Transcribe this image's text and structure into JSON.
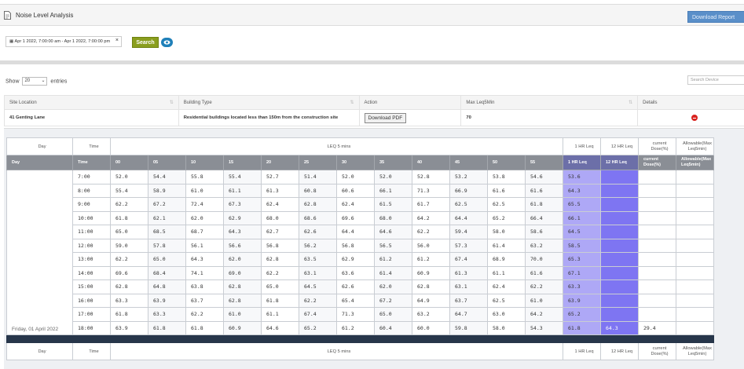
{
  "header": {
    "title": "Noise Level Analysis",
    "download_report": "Download Report"
  },
  "filter": {
    "date_range": "Apr 1 2022, 7:00:00 am - Apr 1 2022, 7:00:00 pm",
    "search_label": "Search"
  },
  "list": {
    "show_label": "Show",
    "entries_value": "20",
    "entries_label": "entries",
    "search_placeholder": "Search Device"
  },
  "site_table": {
    "headers": [
      "Site Location",
      "Building Type",
      "Action",
      "Max Leq5Min",
      "Details"
    ],
    "row": {
      "site": "41 Genting Lane",
      "building": "Residential buildings located less than 150m from the construction site",
      "action": "Download PDF",
      "max_leq": "70"
    }
  },
  "leq_table": {
    "h_day": "Day",
    "h_time": "Time",
    "h_leq": "LEQ 5 mins",
    "h_1hr": "1 HR Leq",
    "h_12hr": "12 HR Leq",
    "h_dose": "current Dose(%)",
    "h_allow": "Allowable(Max Leq5min)",
    "minutes": [
      "00",
      "05",
      "10",
      "15",
      "20",
      "25",
      "30",
      "35",
      "40",
      "45",
      "50",
      "55"
    ],
    "rows": [
      {
        "time": "7:00",
        "v": [
          "52.0",
          "54.4",
          "55.8",
          "55.4",
          "52.7",
          "51.4",
          "52.0",
          "52.0",
          "52.8",
          "53.2",
          "53.8",
          "54.6"
        ],
        "hr": "53.6"
      },
      {
        "time": "8:00",
        "v": [
          "55.4",
          "58.9",
          "61.0",
          "61.1",
          "61.3",
          "60.8",
          "60.6",
          "66.1",
          "71.3",
          "66.9",
          "61.6",
          "61.6"
        ],
        "hr": "64.3"
      },
      {
        "time": "9:00",
        "v": [
          "62.2",
          "67.2",
          "72.4",
          "67.3",
          "62.4",
          "62.8",
          "62.4",
          "61.5",
          "61.7",
          "62.5",
          "62.5",
          "61.8"
        ],
        "hr": "65.5"
      },
      {
        "time": "10:00",
        "v": [
          "61.8",
          "62.1",
          "62.0",
          "62.9",
          "68.0",
          "68.6",
          "69.6",
          "68.0",
          "64.2",
          "64.4",
          "65.2",
          "66.4"
        ],
        "hr": "66.1"
      },
      {
        "time": "11:00",
        "v": [
          "65.0",
          "68.5",
          "68.7",
          "64.3",
          "62.7",
          "62.6",
          "64.4",
          "64.6",
          "62.2",
          "59.4",
          "58.0",
          "58.6"
        ],
        "hr": "64.5"
      },
      {
        "time": "12:00",
        "v": [
          "59.0",
          "57.8",
          "56.1",
          "56.6",
          "56.8",
          "56.2",
          "56.8",
          "56.5",
          "56.0",
          "57.3",
          "61.4",
          "63.2"
        ],
        "hr": "58.5"
      },
      {
        "time": "13:00",
        "v": [
          "62.2",
          "65.0",
          "64.3",
          "62.0",
          "62.8",
          "63.5",
          "62.9",
          "61.2",
          "61.2",
          "67.4",
          "68.9",
          "70.0"
        ],
        "hr": "65.3"
      },
      {
        "time": "14:00",
        "v": [
          "69.6",
          "68.4",
          "74.1",
          "69.0",
          "62.2",
          "63.1",
          "63.6",
          "61.4",
          "60.9",
          "61.3",
          "61.1",
          "61.6"
        ],
        "hr": "67.1"
      },
      {
        "time": "15:00",
        "v": [
          "62.8",
          "64.8",
          "63.8",
          "62.8",
          "65.0",
          "64.5",
          "62.6",
          "62.0",
          "62.8",
          "63.1",
          "62.4",
          "62.2"
        ],
        "hr": "63.3"
      },
      {
        "time": "16:00",
        "v": [
          "63.3",
          "63.9",
          "63.7",
          "62.8",
          "61.8",
          "62.2",
          "65.4",
          "67.2",
          "64.9",
          "63.7",
          "62.5",
          "61.0"
        ],
        "hr": "63.9"
      },
      {
        "time": "17:00",
        "v": [
          "61.8",
          "63.3",
          "62.2",
          "61.0",
          "61.1",
          "67.4",
          "71.3",
          "65.0",
          "63.2",
          "64.7",
          "63.0",
          "64.2"
        ],
        "hr": "65.2"
      },
      {
        "time": "18:00",
        "v": [
          "63.9",
          "61.8",
          "61.8",
          "60.9",
          "64.6",
          "65.2",
          "61.2",
          "60.4",
          "60.0",
          "59.8",
          "58.0",
          "54.3"
        ],
        "hr": "61.8"
      }
    ],
    "day": "Friday, 01 April 2022",
    "hr12": "64.3",
    "dose": "29.4"
  }
}
